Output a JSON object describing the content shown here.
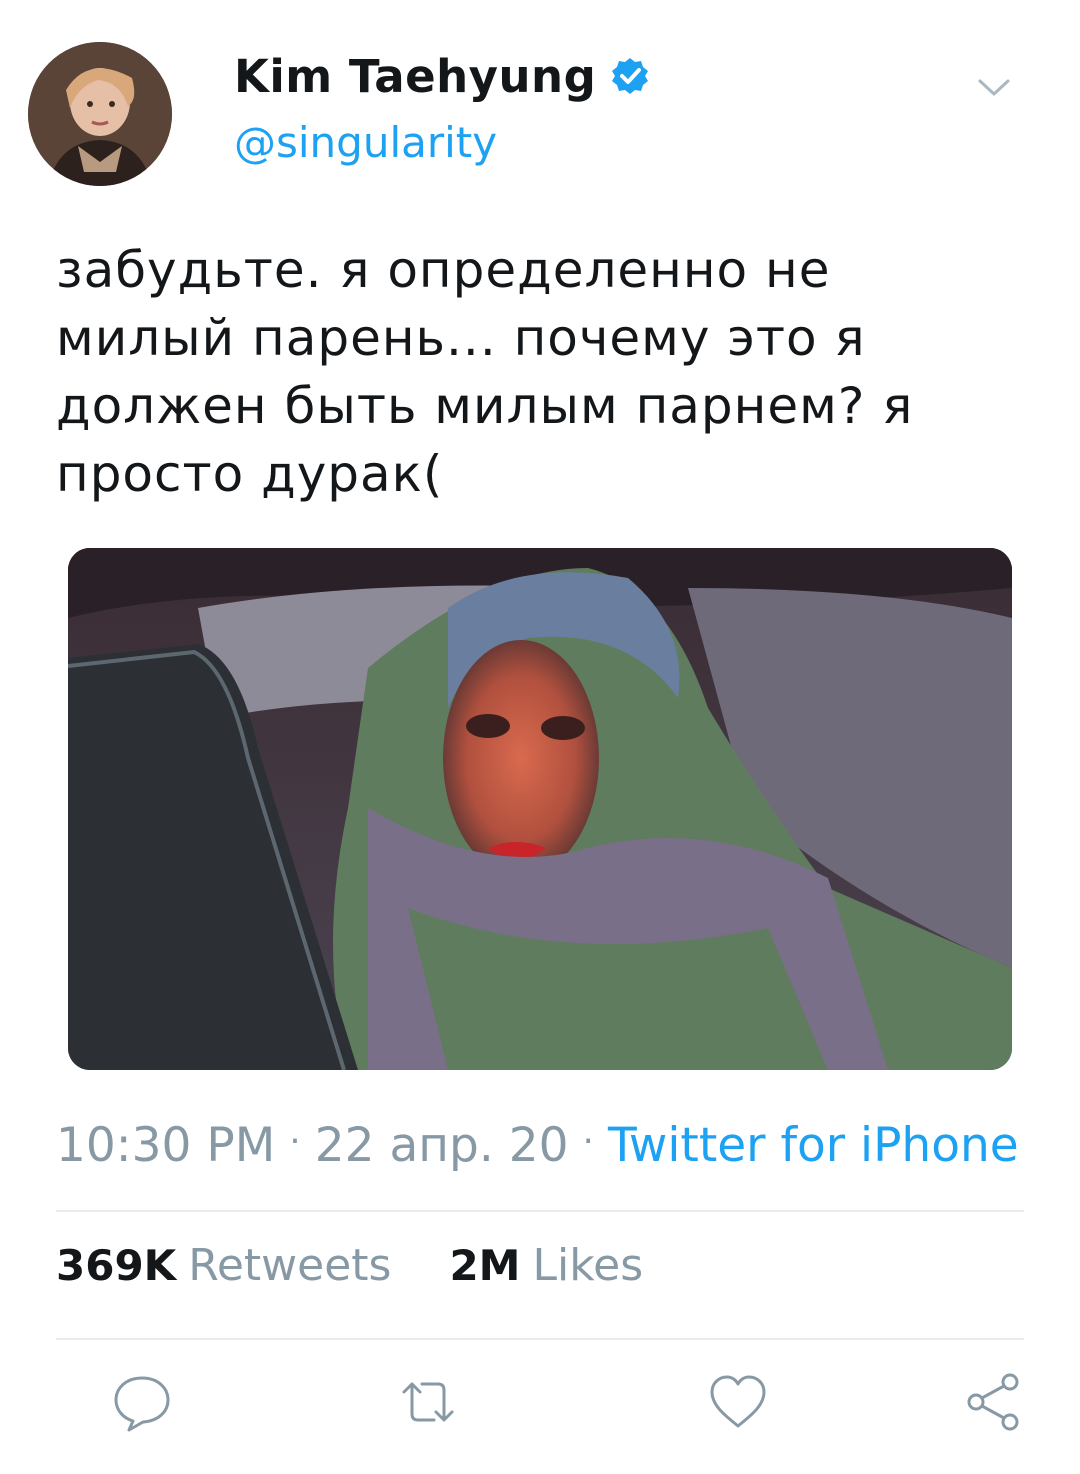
{
  "user": {
    "display_name": "Kim Taehyung",
    "handle": "@singularity",
    "verified": true
  },
  "tweet": {
    "text": "забудьте. я определенно не\nмилый парень... почему это я\nдолжен быть милым парнем? я\nпросто дурак("
  },
  "meta": {
    "time": "10:30 PM",
    "date": "22 апр. 20",
    "separator": "·",
    "source": "Twitter for iPhone"
  },
  "stats": {
    "retweets_count": "369K",
    "retweets_label": "Retweets",
    "likes_count": "2M",
    "likes_label": "Likes"
  },
  "icons": {
    "verified": "verified-badge-icon",
    "menu": "chevron-down-icon",
    "reply": "reply-icon",
    "retweet": "retweet-icon",
    "like": "heart-icon",
    "share": "share-icon"
  },
  "colors": {
    "accent": "#1da1f2",
    "text": "#14171a",
    "muted": "#8899a6",
    "divider": "#e6ecf0"
  }
}
